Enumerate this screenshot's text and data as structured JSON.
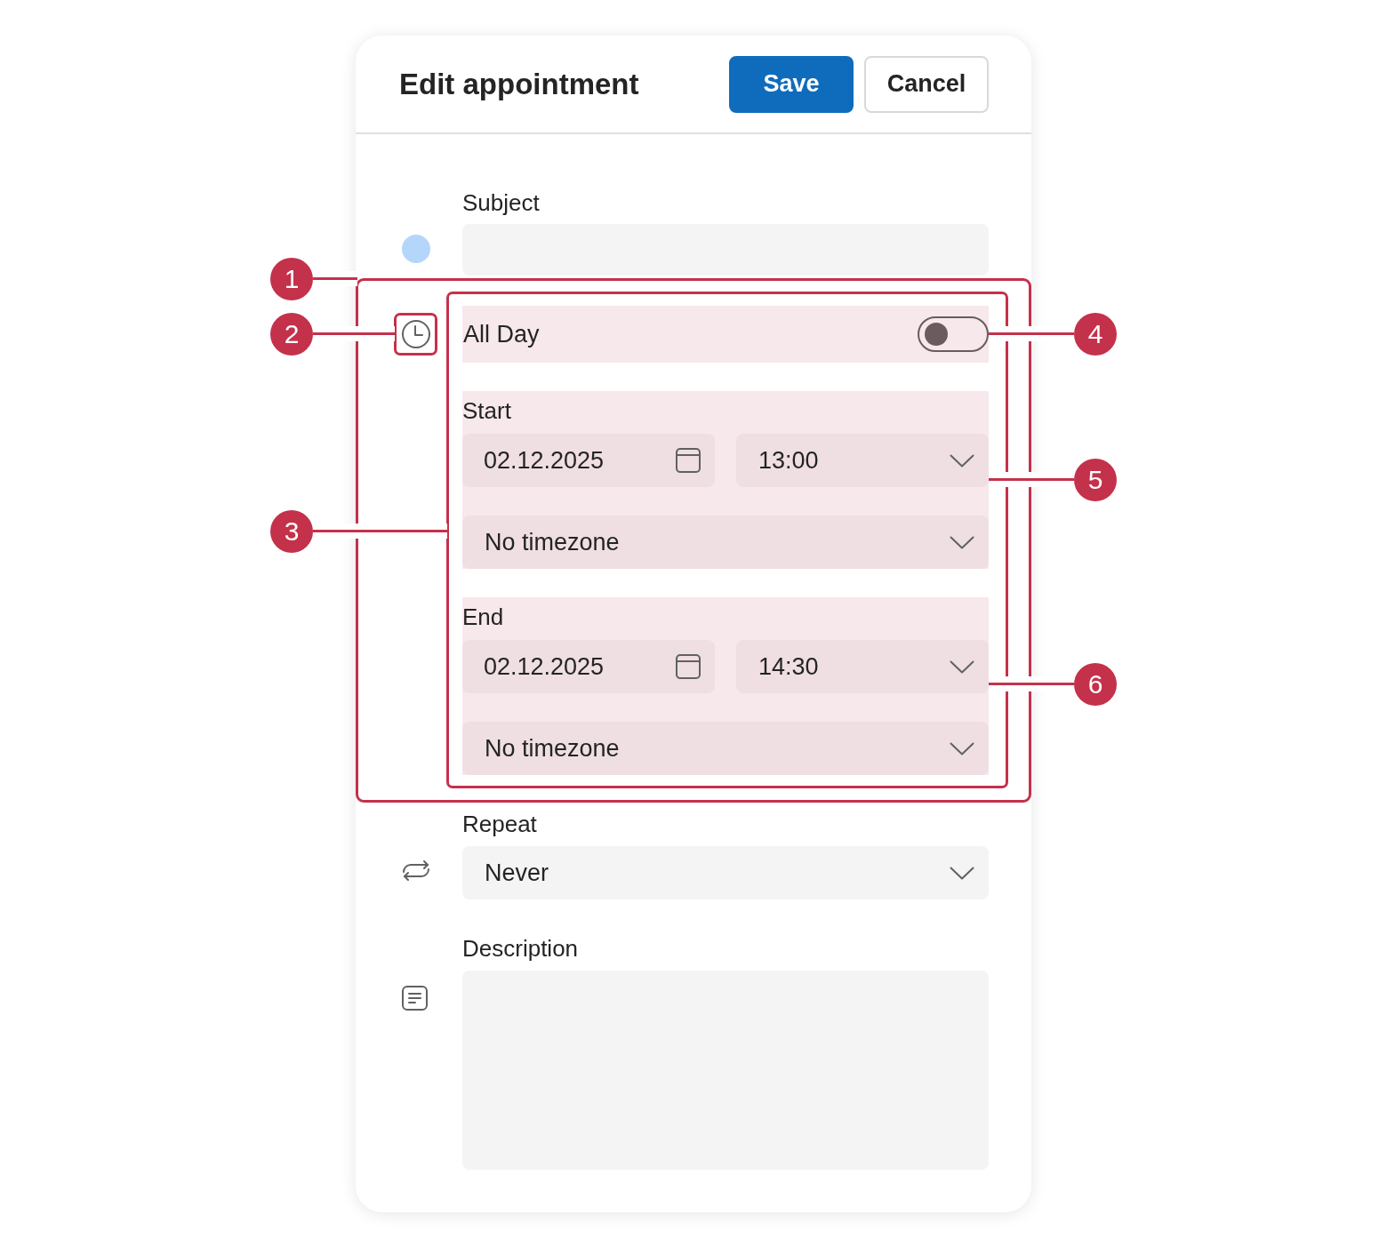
{
  "dialog": {
    "title": "Edit appointment",
    "buttons": [
      {
        "label": "Save",
        "kind": "primary"
      },
      {
        "label": "Cancel",
        "kind": "secondary"
      }
    ]
  },
  "subject": {
    "label": "Subject"
  },
  "all_day": {
    "label": "All Day",
    "on": false,
    "highlighted": true
  },
  "start": {
    "label": "Start",
    "date": "02.12.2025",
    "time": "13:00",
    "timezone": "No timezone",
    "highlighted": true
  },
  "end": {
    "label": "End",
    "date": "02.12.2025",
    "time": "14:30",
    "timezone": "No timezone",
    "highlighted": true
  },
  "repeat": {
    "label": "Repeat",
    "value": "Never"
  },
  "description": {
    "label": "Description"
  },
  "callouts": [
    {
      "number": "1"
    },
    {
      "number": "2"
    },
    {
      "number": "3"
    },
    {
      "number": "4"
    },
    {
      "number": "5"
    },
    {
      "number": "6"
    }
  ]
}
